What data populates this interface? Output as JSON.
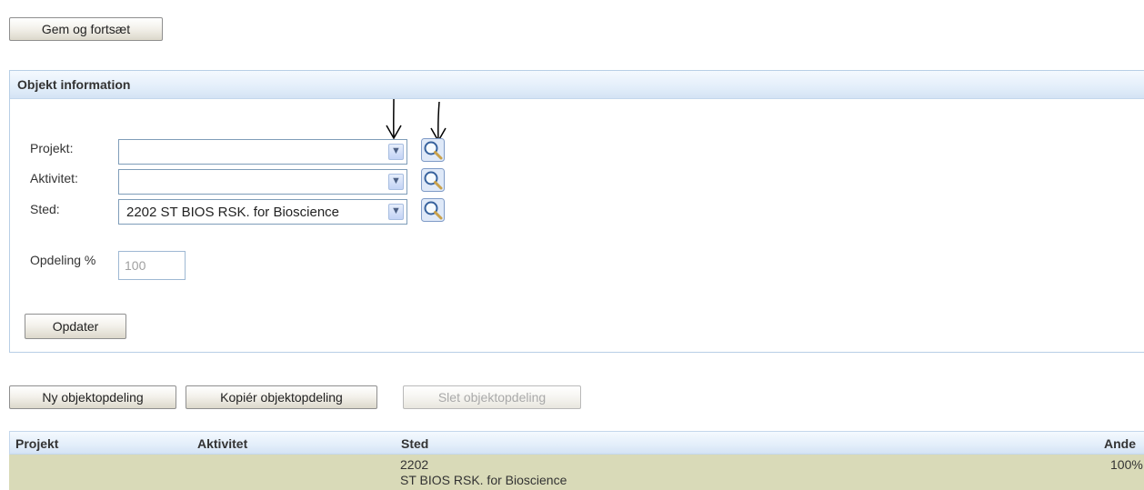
{
  "toolbar": {
    "save_continue_label": "Gem og fortsæt"
  },
  "panel": {
    "title": "Objekt information",
    "fields": {
      "projekt_label": "Projekt:",
      "projekt_value": "",
      "aktivitet_label": "Aktivitet:",
      "aktivitet_value": "",
      "sted_label": "Sted:",
      "sted_value": "2202 ST BIOS RSK. for Bioscience",
      "opdeling_label": "Opdeling %",
      "opdeling_value": "100"
    },
    "update_label": "Opdater"
  },
  "actions": {
    "new_label": "Ny objektopdeling",
    "copy_label": "Kopiér objektopdeling",
    "delete_label": "Slet objektopdeling"
  },
  "grid": {
    "headers": {
      "projekt": "Projekt",
      "aktivitet": "Aktivitet",
      "sted": "Sted",
      "andel": "Ande"
    },
    "rows": [
      {
        "projekt": "",
        "aktivitet": "",
        "sted_code": "2202",
        "sted_name": "ST BIOS RSK. for Bioscience",
        "andel": "100%"
      }
    ]
  },
  "colors": {
    "panel_header": "#dde9f7",
    "selected_row": "#d9dab8",
    "border": "#b8cfe6"
  },
  "icons": {
    "dropdown": "chevron-down-icon",
    "lookup": "magnifier-icon",
    "annotation": "arrow-down-icon"
  }
}
